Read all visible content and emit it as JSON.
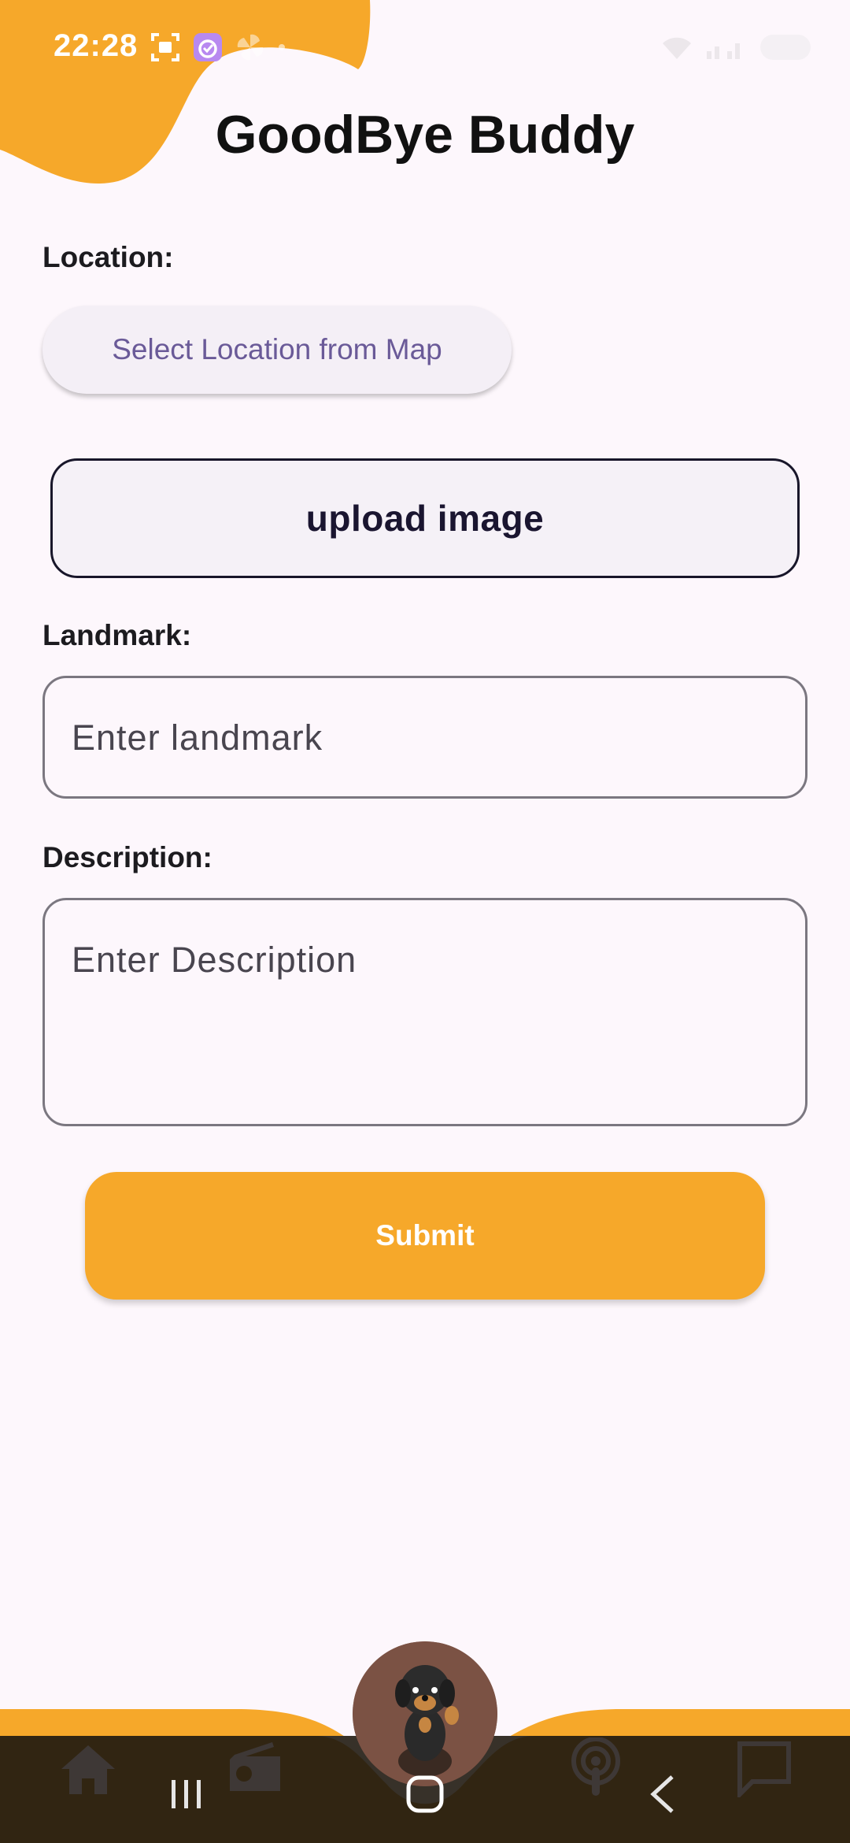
{
  "status_bar": {
    "time": "22:28"
  },
  "app": {
    "title": "GoodBye Buddy"
  },
  "form": {
    "location_label": "Location:",
    "map_button_label": "Select Location from Map",
    "upload_button_label": "upload image",
    "landmark_label": "Landmark:",
    "landmark_placeholder": "Enter landmark",
    "description_label": "Description:",
    "description_placeholder": "Enter Description",
    "submit_label": "Submit"
  },
  "bottom_nav": {
    "items": [
      "home-icon",
      "radio-icon",
      "podcast-icon",
      "chat-icon"
    ],
    "center_avatar": "dog-avatar"
  },
  "system_nav": {
    "buttons": [
      "recents-button",
      "home-button",
      "back-button"
    ]
  },
  "colors": {
    "accent": "#f6a82a",
    "background": "#fdf7fc",
    "button_text": "#6a5a98",
    "nav_bar": "#312512"
  }
}
